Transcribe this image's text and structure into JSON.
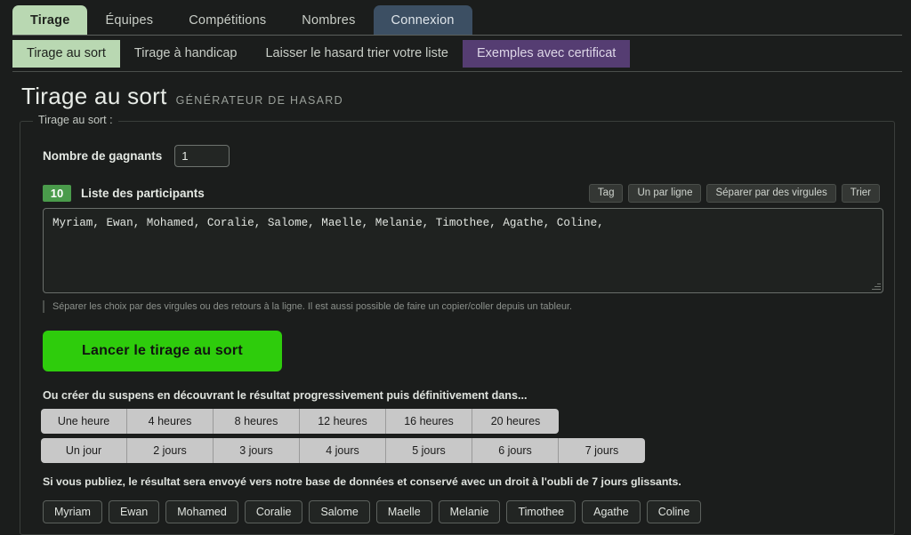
{
  "topnav": {
    "tabs": [
      {
        "label": "Tirage",
        "state": "active-green"
      },
      {
        "label": "Équipes",
        "state": "normal"
      },
      {
        "label": "Compétitions",
        "state": "normal"
      },
      {
        "label": "Nombres",
        "state": "normal"
      },
      {
        "label": "Connexion",
        "state": "active-blue"
      }
    ]
  },
  "subnav": {
    "tabs": [
      {
        "label": "Tirage au sort",
        "state": "active"
      },
      {
        "label": "Tirage à handicap",
        "state": "normal"
      },
      {
        "label": "Laisser le hasard trier votre liste",
        "state": "normal"
      },
      {
        "label": "Exemples avec certificat",
        "state": "purple"
      }
    ]
  },
  "header": {
    "title": "Tirage au sort",
    "subtitle": "GÉNÉRATEUR DE HASARD"
  },
  "form": {
    "legend": "Tirage au sort :",
    "winners_label": "Nombre de gagnants",
    "winners_value": "1",
    "winners_placeholder": "1",
    "participants_count": "10",
    "participants_label": "Liste des participants",
    "tools": [
      {
        "label": "Tag"
      },
      {
        "label": "Un par ligne"
      },
      {
        "label": "Séparer par des virgules"
      },
      {
        "label": "Trier"
      }
    ],
    "participants_value": "Myriam, Ewan, Mohamed, Coralie, Salome, Maelle, Melanie, Timothee, Agathe, Coline,",
    "participants_placeholder": "Myriam, Ewan, Mohamed",
    "helper": "Séparer les choix par des virgules ou des retours à la ligne. Il est aussi possible de faire un copier/coller depuis un tableur.",
    "launch_label": "Lancer le tirage au sort",
    "suspense_text": "Ou créer du suspens en découvrant le résultat progressivement puis définitivement dans...",
    "durations_hours": [
      "Une heure",
      "4 heures",
      "8 heures",
      "12 heures",
      "16 heures",
      "20 heures"
    ],
    "durations_days": [
      "Un jour",
      "2 jours",
      "3 jours",
      "4 jours",
      "5 jours",
      "6 jours",
      "7 jours"
    ],
    "notice": "Si vous publiez, le résultat sera envoyé vers notre base de données et conservé avec un droit à l'oubli de 7 jours glissants."
  },
  "chips": [
    "Myriam",
    "Ewan",
    "Mohamed",
    "Coralie",
    "Salome",
    "Maelle",
    "Melanie",
    "Timothee",
    "Agathe",
    "Coline"
  ],
  "colors": {
    "background": "#1b1d1c",
    "accent_green": "#b9d8b2",
    "badge_green": "#4a9b4b",
    "launch_green": "#2ecc0c",
    "tab_blue": "#3c4f63",
    "tab_purple": "#553d72"
  }
}
